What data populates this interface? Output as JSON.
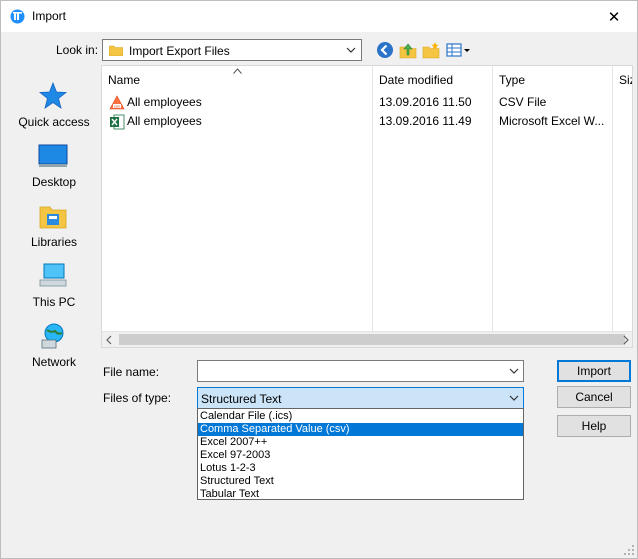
{
  "window": {
    "title": "Import",
    "close_glyph": "✕",
    "icon": "app-icon"
  },
  "lookin": {
    "label": "Look in:",
    "value": "Import Export Files"
  },
  "toolbar": {
    "icons": [
      "back-icon",
      "up-folder-icon",
      "new-folder-icon",
      "view-menu-icon"
    ]
  },
  "places": [
    {
      "label": "Quick access",
      "icon": "quick-access-star-icon"
    },
    {
      "label": "Desktop",
      "icon": "desktop-icon"
    },
    {
      "label": "Libraries",
      "icon": "libraries-icon"
    },
    {
      "label": "This PC",
      "icon": "this-pc-icon"
    },
    {
      "label": "Network",
      "icon": "network-icon"
    }
  ],
  "filelist": {
    "columns": [
      "Name",
      "Date modified",
      "Type",
      "Siz"
    ],
    "rows": [
      {
        "name": "All employees",
        "date": "13.09.2016 11.50",
        "type": "CSV File",
        "icon": "csv-file-icon"
      },
      {
        "name": "All employees",
        "date": "13.09.2016 11.49",
        "type": "Microsoft Excel W...",
        "icon": "excel-file-icon"
      }
    ]
  },
  "form": {
    "filename_label": "File name:",
    "filename_value": "",
    "filetype_label": "Files of type:",
    "filetype_value": "Structured Text",
    "filetype_options": [
      "Calendar File (.ics)",
      "Comma Separated Value (csv)",
      "Excel 2007++",
      "Excel 97-2003",
      "Lotus 1-2-3",
      "Structured Text",
      "Tabular Text"
    ],
    "highlighted_option_index": 1
  },
  "buttons": {
    "import": "Import",
    "cancel": "Cancel",
    "help": "Help"
  },
  "colors": {
    "accent": "#0078d7",
    "select_bg": "#cce4f7",
    "dialog_bg": "#f0f0f0"
  }
}
